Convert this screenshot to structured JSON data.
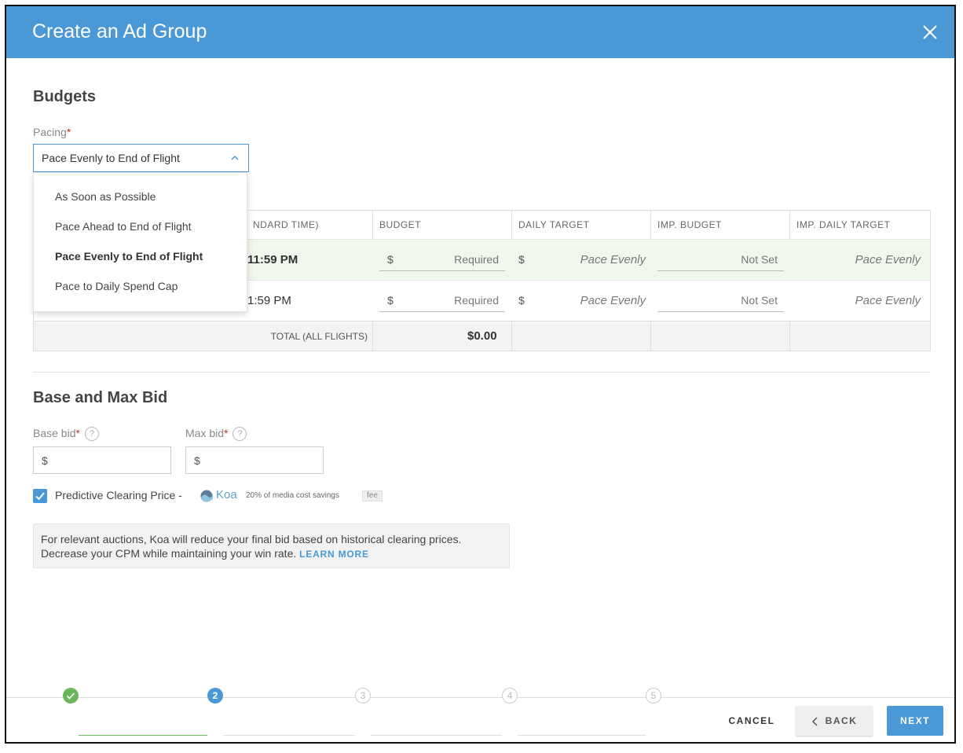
{
  "header": {
    "title": "Create an Ad Group",
    "close_icon": "close-icon"
  },
  "budgets": {
    "title": "Budgets",
    "pacing_label": "Pacing",
    "required_mark": "*",
    "pacing_value": "Pace Evenly to End of Flight",
    "pacing_options": [
      "As Soon as Possible",
      "Pace Ahead to End of Flight",
      "Pace Evenly to End of Flight",
      "Pace to Daily Spend Cap"
    ],
    "table": {
      "headers": [
        "NDARD TIME)",
        "BUDGET",
        "DAILY TARGET",
        "IMP. BUDGET",
        "IMP. DAILY TARGET"
      ],
      "rows": [
        {
          "time": "11:59 PM",
          "currency": "$",
          "budget_placeholder": "Required",
          "daily_currency": "$",
          "daily_target": "Pace Evenly",
          "imp_budget": "Not Set",
          "imp_daily_target": "Pace Evenly"
        },
        {
          "time": "1:59 PM",
          "currency": "$",
          "budget_placeholder": "Required",
          "daily_currency": "$",
          "daily_target": "Pace Evenly",
          "imp_budget": "Not Set",
          "imp_daily_target": "Pace Evenly"
        }
      ],
      "total_label": "TOTAL (ALL FLIGHTS)",
      "total_value": "$0.00"
    }
  },
  "bid": {
    "title": "Base and Max Bid",
    "base_label": "Base bid",
    "max_label": "Max bid",
    "help_icon": "?",
    "currency": "$",
    "predictive_label": "Predictive Clearing Price -",
    "predictive_checked": true,
    "koa_name": "Koa",
    "savings_text": "20% of media cost savings",
    "fee_badge": "fee",
    "info_text": "For relevant auctions, Koa will reduce your final bid based on historical clearing prices. Decrease your CPM while maintaining your win rate.",
    "learn_more": "LEARN MORE"
  },
  "footer": {
    "steps": [
      "2",
      "3",
      "4",
      "5"
    ],
    "current_step": 2,
    "cancel": "CANCEL",
    "back": "BACK",
    "next": "NEXT"
  },
  "colors": {
    "accent": "#4a98d6",
    "success": "#6db55a",
    "required": "#c0392b"
  }
}
